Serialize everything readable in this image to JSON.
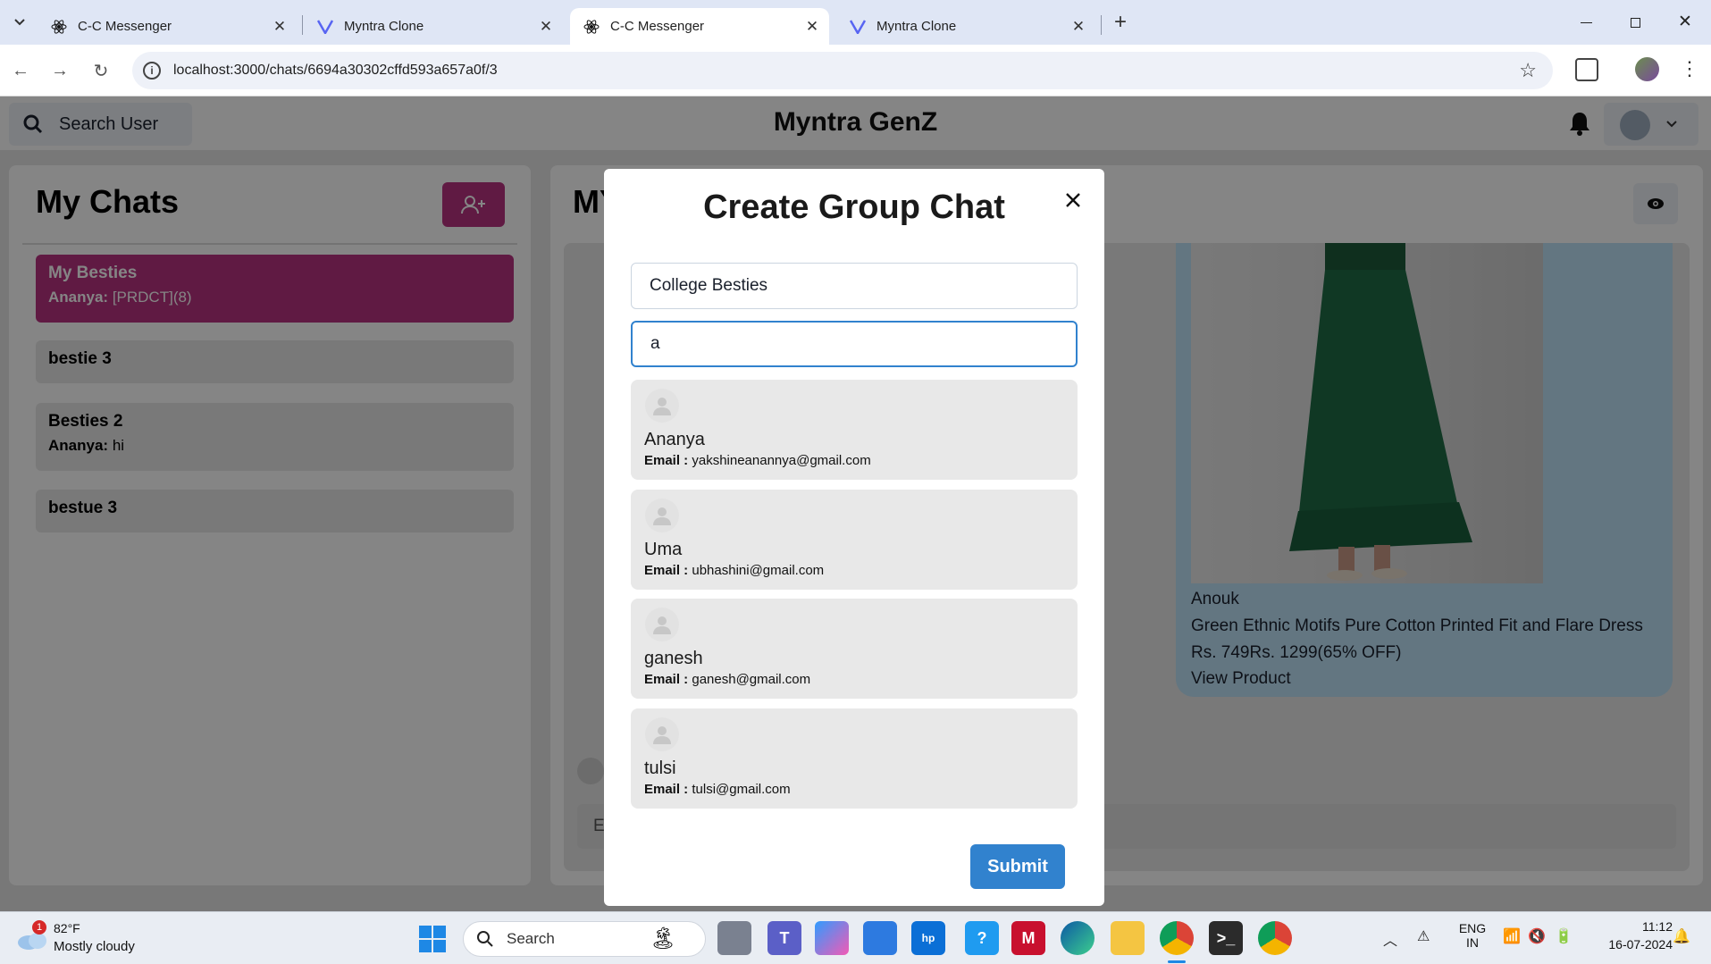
{
  "browser": {
    "tabs": [
      {
        "title": "C-C Messenger",
        "active": false
      },
      {
        "title": "Myntra Clone",
        "active": false
      },
      {
        "title": "C-C Messenger",
        "active": true
      },
      {
        "title": "Myntra Clone",
        "active": false
      }
    ],
    "url": "localhost:3000/chats/6694a30302cffd593a657a0f/3"
  },
  "app": {
    "search_label": "Search User",
    "brand": "Myntra GenZ",
    "left_title": "My Chats",
    "right_title_partial": "MY",
    "chats": [
      {
        "name": "My Besties",
        "sender": "Ananya:",
        "message": "[PRDCT](8)",
        "selected": true
      },
      {
        "name": "bestie 3",
        "sender": "",
        "message": "",
        "selected": false
      },
      {
        "name": "Besties 2",
        "sender": "Ananya:",
        "message": "hi",
        "selected": false
      },
      {
        "name": "bestue 3",
        "sender": "",
        "message": "",
        "selected": false
      }
    ],
    "product": {
      "brand": "Anouk",
      "name": "Green Ethnic Motifs Pure Cotton Printed Fit and Flare Dress",
      "price": "Rs. 749Rs. 1299(65% OFF)",
      "link": "View Product"
    },
    "message_placeholder_partial": "E"
  },
  "modal": {
    "title": "Create Group Chat",
    "group_name_value": "College Besties",
    "search_value": "a",
    "email_label": "Email :",
    "users": [
      {
        "name": "Ananya",
        "email": "yakshineanannya@gmail.com"
      },
      {
        "name": "Uma",
        "email": "ubhashini@gmail.com"
      },
      {
        "name": "ganesh",
        "email": "ganesh@gmail.com"
      },
      {
        "name": "tulsi",
        "email": "tulsi@gmail.com"
      }
    ],
    "submit_label": "Submit"
  },
  "taskbar": {
    "weather_temp": "82°F",
    "weather_desc": "Mostly cloudy",
    "weather_badge": "1",
    "search_label": "Search",
    "lang_top": "ENG",
    "lang_bottom": "IN",
    "time": "11:12",
    "date": "16-07-2024"
  },
  "colors": {
    "accent_pink": "#b83280",
    "button_blue": "#3182ce",
    "tab_bar": "#dfe6f5"
  }
}
